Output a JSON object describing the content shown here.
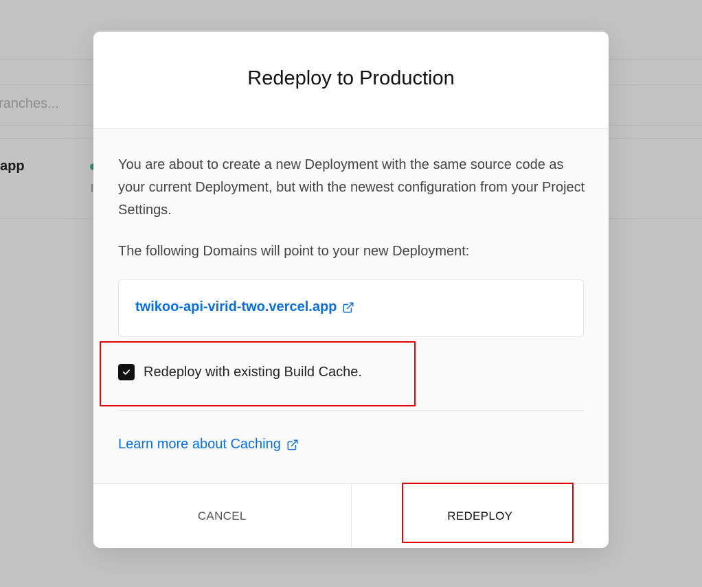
{
  "background": {
    "search_placeholder_fragment": "ranches...",
    "project_name_fragment": "app"
  },
  "modal": {
    "title": "Redeploy to Production",
    "description": "You are about to create a new Deployment with the same source code as your current Deployment, but with the newest configuration from your Project Settings.",
    "domains_intro": "The following Domains will point to your new Deployment:",
    "domains": [
      {
        "label": "twikoo-api-virid-two.vercel.app",
        "icon": "external-link-icon"
      }
    ],
    "build_cache": {
      "label": "Redeploy with existing Build Cache.",
      "checked": true
    },
    "learn_more": {
      "label": "Learn more about Caching",
      "icon": "external-link-icon"
    },
    "buttons": {
      "cancel": "CANCEL",
      "redeploy": "REDEPLOY"
    }
  },
  "colors": {
    "link": "#0b6fdb",
    "highlight": "#e30000",
    "overlay": "#c3c3c3"
  }
}
